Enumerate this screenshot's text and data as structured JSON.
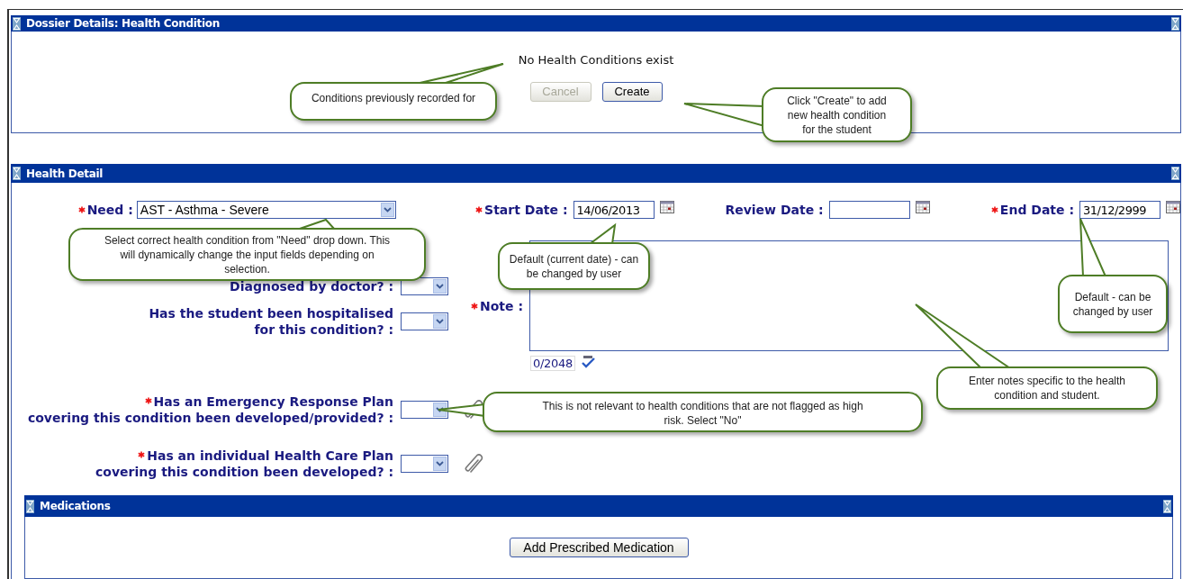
{
  "dossier_panel": {
    "title": "Dossier Details: Health Condition",
    "message": "No Health Conditions exist",
    "buttons": [
      {
        "label": "Cancel",
        "disabled": true
      },
      {
        "label": "Create",
        "disabled": false
      }
    ]
  },
  "health_detail": {
    "title": "Health Detail",
    "need": {
      "label": "Need :",
      "required": true,
      "value": "AST - Asthma - Severe"
    },
    "dates": [
      {
        "label": "Start Date :",
        "required": true,
        "value": "14/06/2013"
      },
      {
        "label": "Review Date :",
        "required": false
      },
      {
        "label": "End Date :",
        "required": true,
        "value": "31/12/2999"
      }
    ],
    "questions": [
      {
        "lines": [
          "Diagnosed by doctor? :"
        ],
        "required": false,
        "attachment": false
      },
      {
        "lines": [
          "Has the student been hospitalised",
          "for this condition? :"
        ],
        "required": false,
        "attachment": false
      },
      {
        "lines": [
          "Has an Emergency Response Plan",
          "covering this condition been developed/provided? :"
        ],
        "required": true,
        "attachment": true
      },
      {
        "lines": [
          "Has an individual Health Care Plan",
          "covering this condition been developed? :"
        ],
        "required": true,
        "attachment": true
      }
    ],
    "note": {
      "label": "Note :",
      "required": true,
      "counter": "0/2048"
    },
    "medications": {
      "title": "Medications",
      "button": "Add Prescribed Medication"
    }
  },
  "callouts": [
    {
      "text": "Conditions previously recorded for"
    },
    {
      "text": "Click \"Create\" to add new health condition for the student"
    },
    {
      "text": "Select correct health condition from \"Need\" drop down. This will dynamically change the input fields depending on selection."
    },
    {
      "text": "Default (current date) - can be changed by user"
    },
    {
      "text": "Default - can be changed by user"
    },
    {
      "text": "Enter notes specific to the health condition and student."
    },
    {
      "text": "This is not relevant to health conditions that are not flagged as high risk. Select \"No\""
    }
  ]
}
